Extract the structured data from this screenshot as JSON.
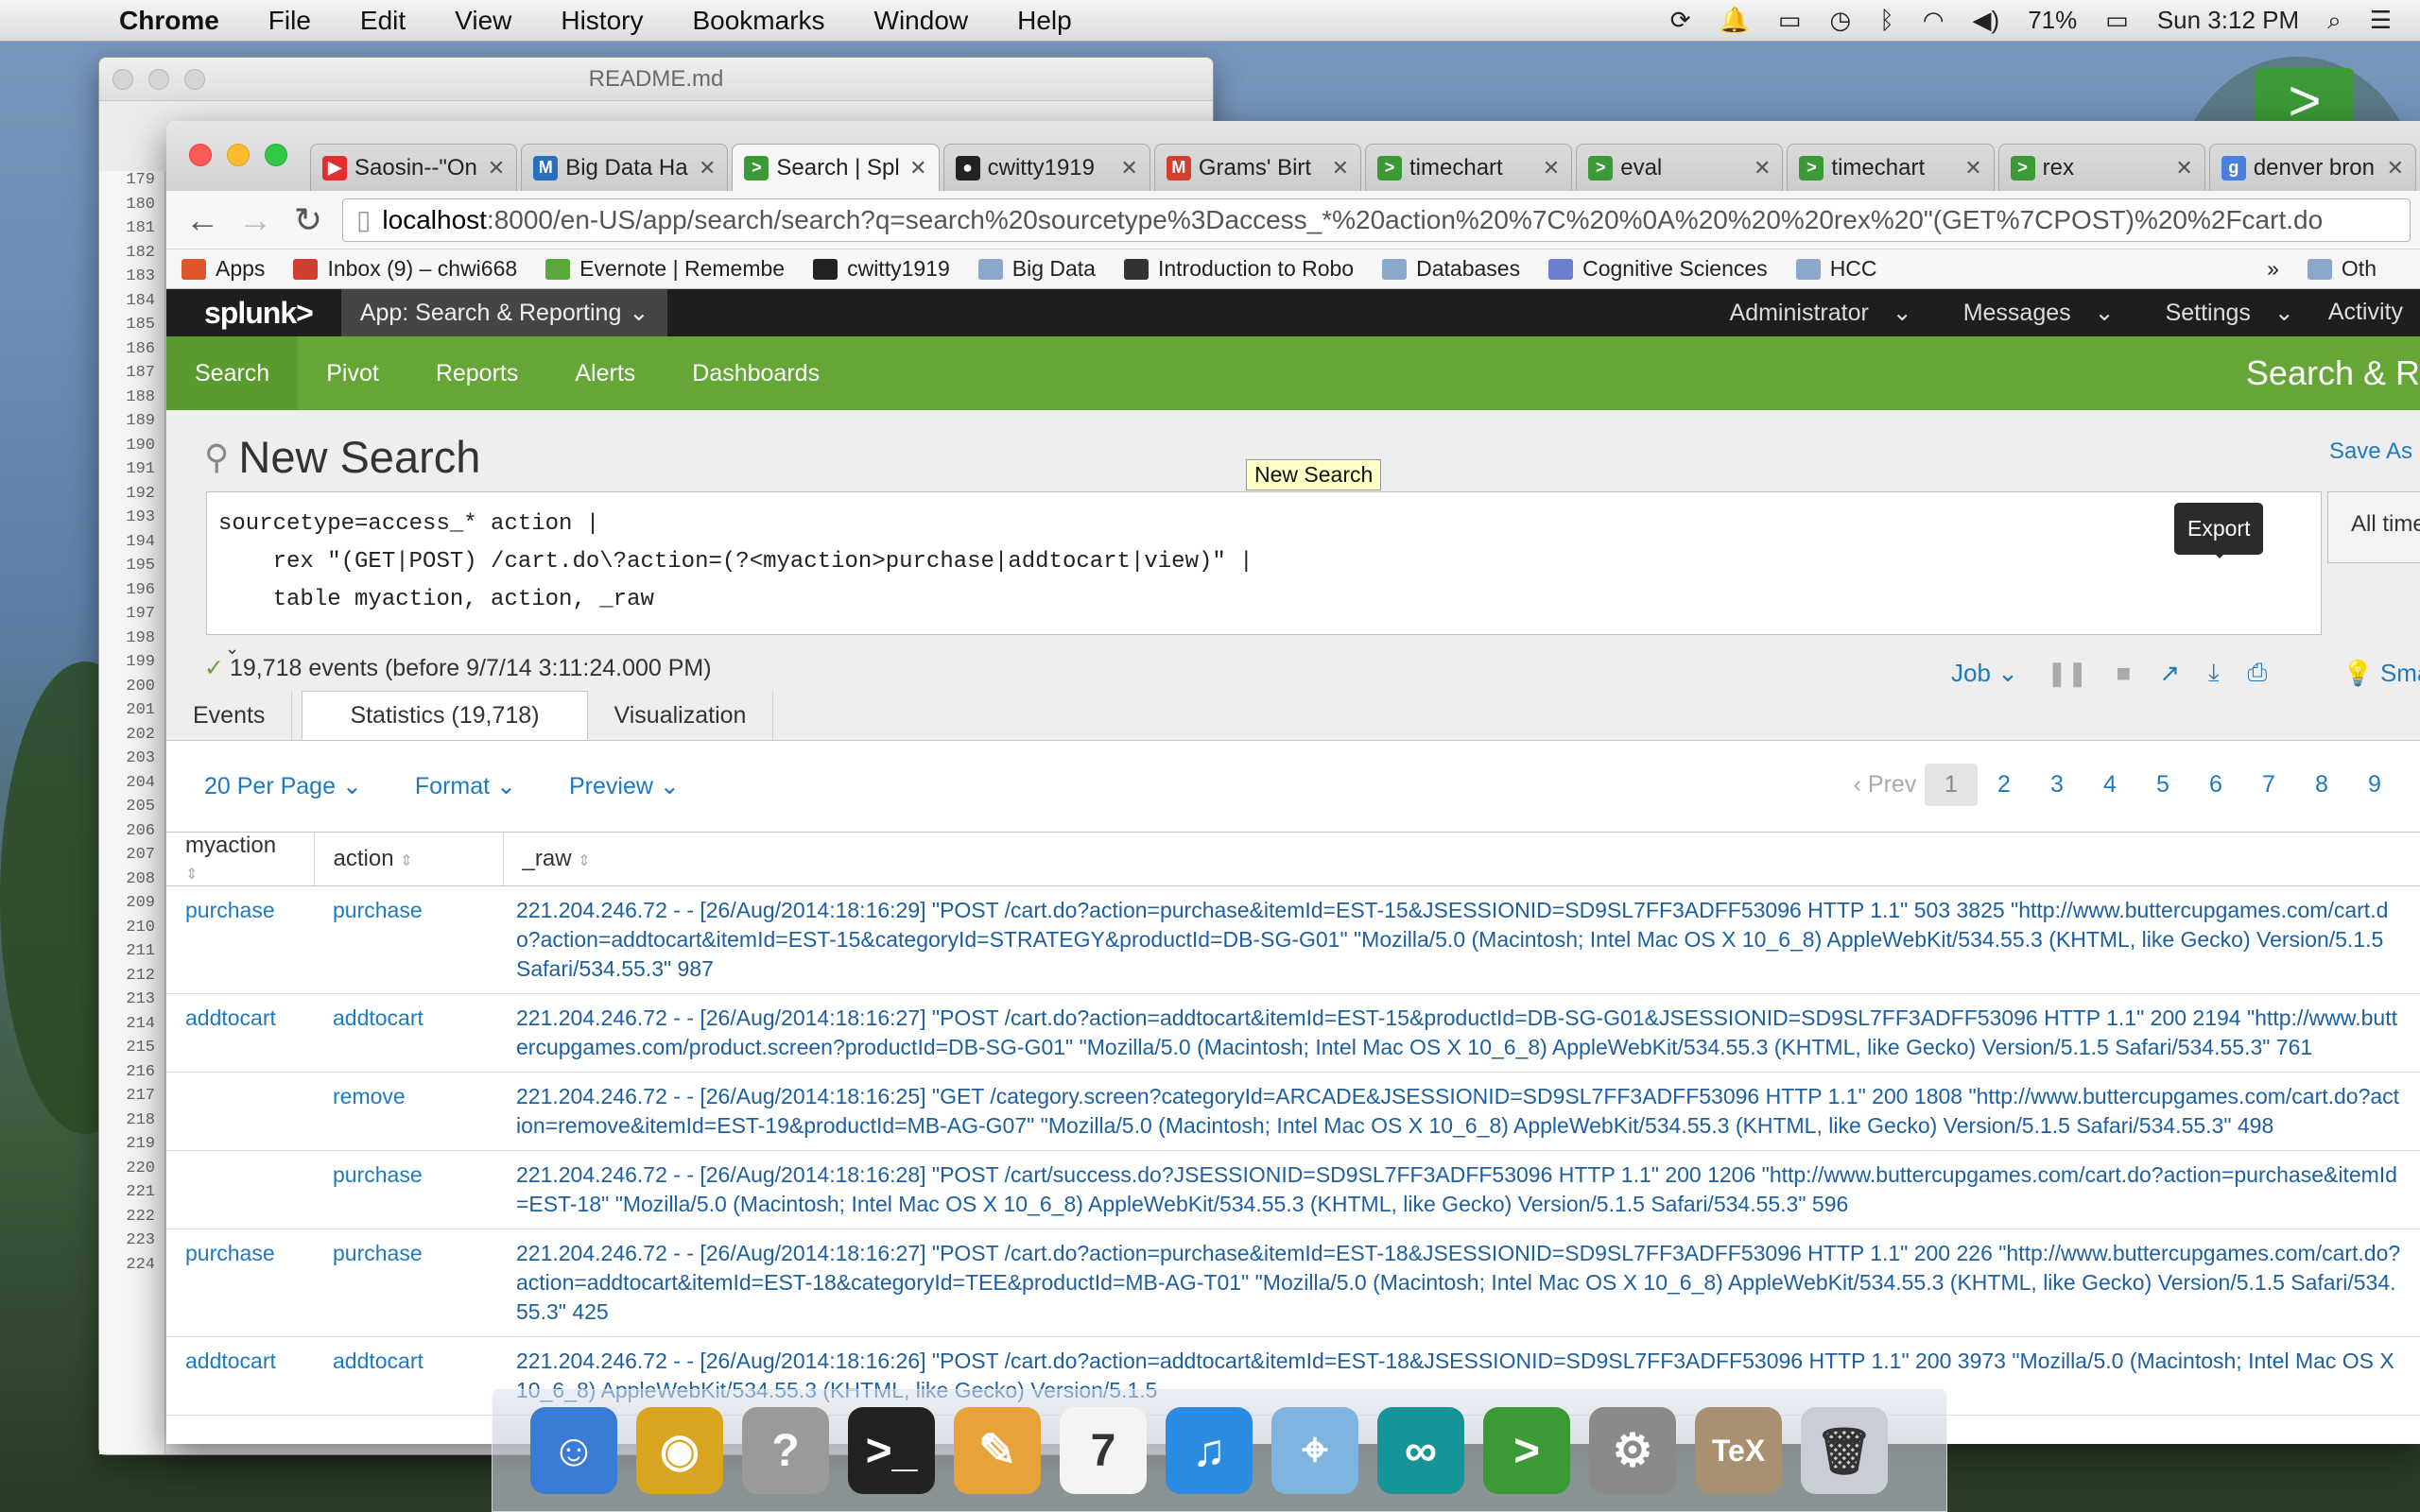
{
  "menubar": {
    "app": "Chrome",
    "items": [
      "File",
      "Edit",
      "View",
      "History",
      "Bookmarks",
      "Window",
      "Help"
    ],
    "battery": "71%",
    "clock": "Sun 3:12 PM"
  },
  "editor": {
    "title": "README.md",
    "line_numbers": [
      "179",
      "180",
      "181",
      "182",
      "183",
      "184",
      "185",
      "186",
      "187",
      "188",
      "189",
      "190",
      "191",
      "192",
      "193",
      "194",
      "195",
      "196",
      "197",
      "198",
      "199",
      "200",
      "201",
      "202",
      "203",
      "204",
      "205",
      "206",
      "207",
      "208",
      "209",
      "210",
      "211",
      "212",
      "213",
      "214",
      "215",
      "216",
      "217",
      "218",
      "219",
      "220",
      "221",
      "222",
      "223",
      "224"
    ]
  },
  "tabs": [
    {
      "label": "Saosin--\"On",
      "icon": "youtube-icon",
      "color": "#e02f2f",
      "glyph": "▶"
    },
    {
      "label": "Big Data Ha",
      "icon": "gmail-icon",
      "color": "#2a6ebd",
      "glyph": "M"
    },
    {
      "label": "Search | Spl",
      "icon": "splunk-icon",
      "color": "#3c9a36",
      "glyph": ">",
      "active": true
    },
    {
      "label": "cwitty1919",
      "icon": "github-icon",
      "color": "#222222",
      "glyph": "●"
    },
    {
      "label": "Grams' Birt",
      "icon": "gmail-icon",
      "color": "#d23f31",
      "glyph": "M"
    },
    {
      "label": "timechart",
      "icon": "splunk-icon",
      "color": "#3c9a36",
      "glyph": ">"
    },
    {
      "label": "eval",
      "icon": "splunk-icon",
      "color": "#3c9a36",
      "glyph": ">"
    },
    {
      "label": "timechart",
      "icon": "splunk-icon",
      "color": "#3c9a36",
      "glyph": ">"
    },
    {
      "label": "rex",
      "icon": "splunk-icon",
      "color": "#3c9a36",
      "glyph": ">"
    },
    {
      "label": "denver bron",
      "icon": "google-icon",
      "color": "#4a7fe0",
      "glyph": "g"
    }
  ],
  "url": {
    "host": "localhost",
    "rest": ":8000/en-US/app/search/search?q=search%20sourcetype%3Daccess_*%20action%20%7C%20%0A%20%20%20rex%20\"(GET%7CPOST)%20%2Fcart.do"
  },
  "bookmarks": [
    {
      "label": "Apps",
      "icon": "apps-grid-icon",
      "color": "#e0562a"
    },
    {
      "label": "Inbox (9) – chwi668",
      "icon": "gmail-icon",
      "color": "#d23f31"
    },
    {
      "label": "Evernote | Remembe",
      "icon": "evernote-icon",
      "color": "#5aa83a"
    },
    {
      "label": "cwitty1919",
      "icon": "github-icon",
      "color": "#222222"
    },
    {
      "label": "Big Data",
      "icon": "folder-icon",
      "color": "#8aa7cc"
    },
    {
      "label": "Introduction to Robo",
      "icon": "coursera-icon",
      "color": "#333333"
    },
    {
      "label": "Databases",
      "icon": "folder-icon",
      "color": "#8aa7cc"
    },
    {
      "label": "Cognitive Sciences",
      "icon": "gear-icon",
      "color": "#6b7ecf"
    },
    {
      "label": "HCC",
      "icon": "folder-icon",
      "color": "#8aa7cc"
    }
  ],
  "bookmarks_more": "»",
  "bookmarks_other": "Oth",
  "splunk": {
    "logo": "splunk>",
    "app": "App: Search & Reporting",
    "right_menu": [
      "Administrator",
      "Messages",
      "Settings",
      "Activity"
    ],
    "nav": [
      "Search",
      "Pivot",
      "Reports",
      "Alerts",
      "Dashboards"
    ],
    "app_title": "Search & R",
    "page_title": "New Search",
    "save_as": "Save As",
    "query": "sourcetype=access_* action |\n    rex \"(GET|POST) /cart.do\\?action=(?<myaction>purchase|addtocart|view)\" |\n    table myaction, action, _raw",
    "tooltip": "New Search",
    "export_tip": "Export",
    "time_range": "All time",
    "status": "19,718 events (before 9/7/14 3:11:24.000 PM)",
    "job_label": "Job",
    "smart": "Sma",
    "result_tabs": [
      "Events",
      "Statistics (19,718)",
      "Visualization"
    ],
    "controls": [
      "20 Per Page",
      "Format",
      "Preview"
    ],
    "pager": {
      "prev": "Prev",
      "pages": [
        "1",
        "2",
        "3",
        "4",
        "5",
        "6",
        "7",
        "8",
        "9"
      ]
    },
    "columns": [
      "myaction",
      "action",
      "_raw"
    ],
    "rows": [
      {
        "myaction": "purchase",
        "action": "purchase",
        "raw": "221.204.246.72 - - [26/Aug/2014:18:16:29] \"POST /cart.do?action=purchase&itemId=EST-15&JSESSIONID=SD9SL7FF3ADFF53096 HTTP 1.1\" 503 3825 \"http://www.buttercupgames.com/cart.do?action=addtocart&itemId=EST-15&categoryId=STRATEGY&productId=DB-SG-G01\" \"Mozilla/5.0 (Macintosh; Intel Mac OS X 10_6_8) AppleWebKit/534.55.3 (KHTML, like Gecko) Version/5.1.5 Safari/534.55.3\" 987"
      },
      {
        "myaction": "addtocart",
        "action": "addtocart",
        "raw": "221.204.246.72 - - [26/Aug/2014:18:16:27] \"POST /cart.do?action=addtocart&itemId=EST-15&productId=DB-SG-G01&JSESSIONID=SD9SL7FF3ADFF53096 HTTP 1.1\" 200 2194 \"http://www.buttercupgames.com/product.screen?productId=DB-SG-G01\" \"Mozilla/5.0 (Macintosh; Intel Mac OS X 10_6_8) AppleWebKit/534.55.3 (KHTML, like Gecko) Version/5.1.5 Safari/534.55.3\" 761"
      },
      {
        "myaction": "",
        "action": "remove",
        "raw": "221.204.246.72 - - [26/Aug/2014:18:16:25] \"GET /category.screen?categoryId=ARCADE&JSESSIONID=SD9SL7FF3ADFF53096 HTTP 1.1\" 200 1808 \"http://www.buttercupgames.com/cart.do?action=remove&itemId=EST-19&productId=MB-AG-G07\" \"Mozilla/5.0 (Macintosh; Intel Mac OS X 10_6_8) AppleWebKit/534.55.3 (KHTML, like Gecko) Version/5.1.5 Safari/534.55.3\" 498"
      },
      {
        "myaction": "",
        "action": "purchase",
        "raw": "221.204.246.72 - - [26/Aug/2014:18:16:28] \"POST /cart/success.do?JSESSIONID=SD9SL7FF3ADFF53096 HTTP 1.1\" 200 1206 \"http://www.buttercupgames.com/cart.do?action=purchase&itemId=EST-18\" \"Mozilla/5.0 (Macintosh; Intel Mac OS X 10_6_8) AppleWebKit/534.55.3 (KHTML, like Gecko) Version/5.1.5 Safari/534.55.3\" 596"
      },
      {
        "myaction": "purchase",
        "action": "purchase",
        "raw": "221.204.246.72 - - [26/Aug/2014:18:16:27] \"POST /cart.do?action=purchase&itemId=EST-18&JSESSIONID=SD9SL7FF3ADFF53096 HTTP 1.1\" 200 226 \"http://www.buttercupgames.com/cart.do?action=addtocart&itemId=EST-18&categoryId=TEE&productId=MB-AG-T01\" \"Mozilla/5.0 (Macintosh; Intel Mac OS X 10_6_8) AppleWebKit/534.55.3 (KHTML, like Gecko) Version/5.1.5 Safari/534.55.3\" 425"
      },
      {
        "myaction": "addtocart",
        "action": "addtocart",
        "raw": "221.204.246.72 - - [26/Aug/2014:18:16:26] \"POST /cart.do?action=addtocart&itemId=EST-18&JSESSIONID=SD9SL7FF3ADFF53096 HTTP 1.1\" 200 3973 \"Mozilla/5.0 (Macintosh; Intel Mac OS X 10_6_8) AppleWebKit/534.55.3 (KHTML, like Gecko) Version/5.1.5"
      }
    ]
  },
  "dock": [
    {
      "icon": "finder-icon",
      "color": "#3a7bd5",
      "glyph": "☺"
    },
    {
      "icon": "chrome-icon",
      "color": "#d9a520",
      "glyph": "◉"
    },
    {
      "icon": "help-icon",
      "color": "#9a9a9a",
      "glyph": "?"
    },
    {
      "icon": "terminal-icon",
      "color": "#222222",
      "glyph": ">_"
    },
    {
      "icon": "pages-icon",
      "color": "#e7a33a",
      "glyph": "✎"
    },
    {
      "icon": "calendar-icon",
      "color": "#f4f4f4",
      "glyph": "7"
    },
    {
      "icon": "itunes-icon",
      "color": "#2a8be0",
      "glyph": "♫"
    },
    {
      "icon": "maps-icon",
      "color": "#7fb3e0",
      "glyph": "⌖"
    },
    {
      "icon": "arduino-icon",
      "color": "#17939a",
      "glyph": "∞"
    },
    {
      "icon": "splunk-icon",
      "color": "#3c9a36",
      "glyph": ">"
    },
    {
      "icon": "system-preferences-icon",
      "color": "#8a8a8a",
      "glyph": "⚙"
    },
    {
      "icon": "latex-icon",
      "color": "#a89070",
      "glyph": "TeX"
    },
    {
      "icon": "trash-icon",
      "color": "#c9ced6",
      "glyph": "🗑"
    }
  ]
}
